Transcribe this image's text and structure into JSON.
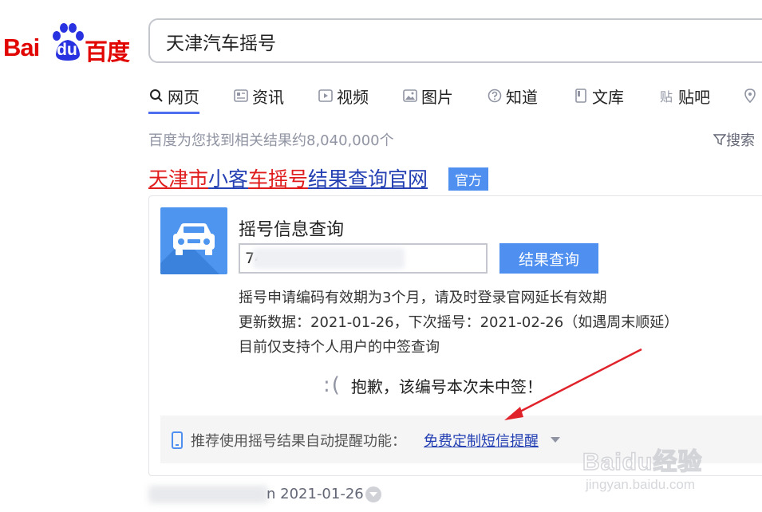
{
  "logo": {
    "bai": "Bai",
    "du": "du",
    "cn": "百度",
    "brand_red": "#e10602",
    "brand_blue": "#2932e1"
  },
  "search": {
    "query": "天津汽车摇号"
  },
  "tabs": [
    {
      "label": "网页",
      "icon": "search-icon",
      "active": true
    },
    {
      "label": "资讯",
      "icon": "news-icon"
    },
    {
      "label": "视频",
      "icon": "video-icon"
    },
    {
      "label": "图片",
      "icon": "image-icon"
    },
    {
      "label": "知道",
      "icon": "question-icon"
    },
    {
      "label": "文库",
      "icon": "document-icon"
    },
    {
      "label": "贴吧",
      "icon": "tieba-icon"
    },
    {
      "label": "",
      "icon": "map-icon"
    }
  ],
  "results_count": "百度为您找到相关结果约8,040,000个",
  "search_tools": "搜索",
  "result": {
    "title_parts": [
      {
        "text": "天津市",
        "color": "red"
      },
      {
        "text": "小客",
        "color": "blue"
      },
      {
        "text": "车摇号",
        "color": "red"
      },
      {
        "text": "结果查询官网",
        "color": "blue"
      }
    ],
    "badge": "官方",
    "card": {
      "heading": "摇号信息查询",
      "input_value": "74",
      "query_button": "结果查询",
      "info_lines": [
        "摇号申请编码有效期为3个月，请及时登录官网延长有效期",
        "更新数据：2021-01-26，下次摇号：2021-02-26（如遇周末顺延）",
        "目前仅支持个人用户的中签查询"
      ],
      "sorry_face": ":(",
      "sorry_text": "抱歉，该编号本次未中签！",
      "footer_text": "推荐使用摇号结果自动提醒功能：",
      "footer_link": "免费定制短信提醒"
    },
    "url_date": "n 2021-01-26"
  },
  "watermark": {
    "main": "Baidu经验",
    "sub": "jingyan.baidu.com"
  },
  "colors": {
    "link_blue": "#2440b3",
    "highlight_red": "#e01b1b",
    "accent": "#4e8ff0",
    "arrow": "#e0232b"
  }
}
